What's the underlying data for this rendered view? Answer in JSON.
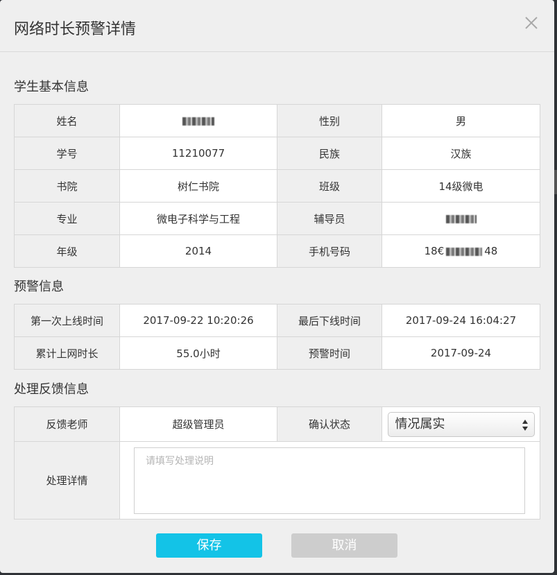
{
  "dialog": {
    "title": "网络时长预警详情",
    "close_icon": "close-icon"
  },
  "student": {
    "section_title": "学生基本信息",
    "name_label": "姓名",
    "gender_label": "性别",
    "gender": "男",
    "id_label": "学号",
    "id": "11210077",
    "ethnicity_label": "民族",
    "ethnicity": "汉族",
    "college_label": "书院",
    "college": "树仁书院",
    "class_label": "班级",
    "class": "14级微电",
    "major_label": "专业",
    "major": "微电子科学与工程",
    "counselor_label": "辅导员",
    "grade_label": "年级",
    "grade": "2014",
    "phone_label": "手机号码",
    "phone_prefix": "18€",
    "phone_suffix": "48"
  },
  "warning": {
    "section_title": "预警信息",
    "first_online_label": "第一次上线时间",
    "first_online": "2017-09-22 10:20:26",
    "last_offline_label": "最后下线时间",
    "last_offline": "2017-09-24 16:04:27",
    "total_label": "累计上网时长",
    "total": "55.0小时",
    "warning_time_label": "预警时间",
    "warning_time": "2017-09-24"
  },
  "feedback": {
    "section_title": "处理反馈信息",
    "teacher_label": "反馈老师",
    "teacher": "超级管理员",
    "status_label": "确认状态",
    "status_selected": "情况属实",
    "detail_label": "处理详情",
    "detail_placeholder": "请填写处理说明"
  },
  "buttons": {
    "save": "保存",
    "cancel": "取消"
  },
  "colors": {
    "save_bg": "#13c3e7",
    "cancel_bg": "#cdcdcd",
    "dialog_bg": "#efefef"
  }
}
